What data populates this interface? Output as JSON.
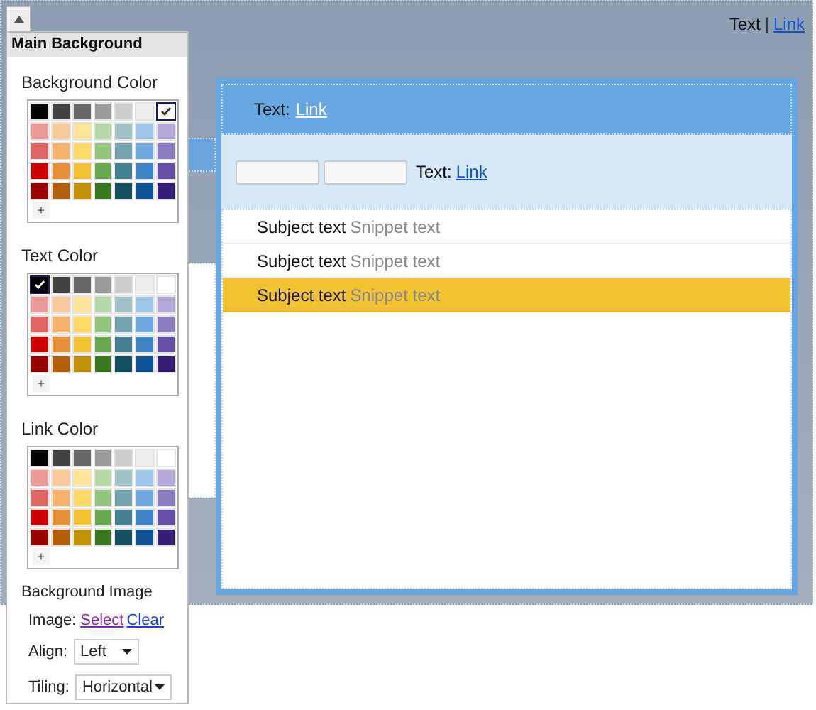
{
  "panel": {
    "title": "Main Background",
    "palettes": [
      {
        "label": "Background Color",
        "add_button": "+",
        "swatches": [
          {
            "color": "#000000",
            "selected": false
          },
          {
            "color": "#434343",
            "selected": false
          },
          {
            "color": "#666666",
            "selected": false
          },
          {
            "color": "#999999",
            "selected": false
          },
          {
            "color": "#cccccc",
            "selected": false
          },
          {
            "color": "#efefef",
            "selected": false
          },
          {
            "color": "#ffffff",
            "selected": true
          },
          {
            "color": "#ea9999",
            "selected": false
          },
          {
            "color": "#f9cb9c",
            "selected": false
          },
          {
            "color": "#ffe599",
            "selected": false
          },
          {
            "color": "#b6d7a8",
            "selected": false
          },
          {
            "color": "#a2c4c9",
            "selected": false
          },
          {
            "color": "#9fc5e8",
            "selected": false
          },
          {
            "color": "#b4a7d6",
            "selected": false
          },
          {
            "color": "#e06666",
            "selected": false
          },
          {
            "color": "#f6b26b",
            "selected": false
          },
          {
            "color": "#ffd966",
            "selected": false
          },
          {
            "color": "#93c47d",
            "selected": false
          },
          {
            "color": "#76a5af",
            "selected": false
          },
          {
            "color": "#6fa8dc",
            "selected": false
          },
          {
            "color": "#8e7cc3",
            "selected": false
          },
          {
            "color": "#cc0000",
            "selected": false
          },
          {
            "color": "#e69138",
            "selected": false
          },
          {
            "color": "#f1c232",
            "selected": false
          },
          {
            "color": "#6aa84f",
            "selected": false
          },
          {
            "color": "#45818e",
            "selected": false
          },
          {
            "color": "#3d85c6",
            "selected": false
          },
          {
            "color": "#674ea7",
            "selected": false
          },
          {
            "color": "#990000",
            "selected": false
          },
          {
            "color": "#b45f06",
            "selected": false
          },
          {
            "color": "#bf9000",
            "selected": false
          },
          {
            "color": "#38761d",
            "selected": false
          },
          {
            "color": "#134f5c",
            "selected": false
          },
          {
            "color": "#0b5394",
            "selected": false
          },
          {
            "color": "#351c75",
            "selected": false
          }
        ]
      },
      {
        "label": "Text Color",
        "add_button": "+",
        "swatches": [
          {
            "color": "#000000",
            "selected": true
          },
          {
            "color": "#434343",
            "selected": false
          },
          {
            "color": "#666666",
            "selected": false
          },
          {
            "color": "#999999",
            "selected": false
          },
          {
            "color": "#cccccc",
            "selected": false
          },
          {
            "color": "#efefef",
            "selected": false
          },
          {
            "color": "#ffffff",
            "selected": false
          },
          {
            "color": "#ea9999",
            "selected": false
          },
          {
            "color": "#f9cb9c",
            "selected": false
          },
          {
            "color": "#ffe599",
            "selected": false
          },
          {
            "color": "#b6d7a8",
            "selected": false
          },
          {
            "color": "#a2c4c9",
            "selected": false
          },
          {
            "color": "#9fc5e8",
            "selected": false
          },
          {
            "color": "#b4a7d6",
            "selected": false
          },
          {
            "color": "#e06666",
            "selected": false
          },
          {
            "color": "#f6b26b",
            "selected": false
          },
          {
            "color": "#ffd966",
            "selected": false
          },
          {
            "color": "#93c47d",
            "selected": false
          },
          {
            "color": "#76a5af",
            "selected": false
          },
          {
            "color": "#6fa8dc",
            "selected": false
          },
          {
            "color": "#8e7cc3",
            "selected": false
          },
          {
            "color": "#cc0000",
            "selected": false
          },
          {
            "color": "#e69138",
            "selected": false
          },
          {
            "color": "#f1c232",
            "selected": false
          },
          {
            "color": "#6aa84f",
            "selected": false
          },
          {
            "color": "#45818e",
            "selected": false
          },
          {
            "color": "#3d85c6",
            "selected": false
          },
          {
            "color": "#674ea7",
            "selected": false
          },
          {
            "color": "#990000",
            "selected": false
          },
          {
            "color": "#b45f06",
            "selected": false
          },
          {
            "color": "#bf9000",
            "selected": false
          },
          {
            "color": "#38761d",
            "selected": false
          },
          {
            "color": "#134f5c",
            "selected": false
          },
          {
            "color": "#0b5394",
            "selected": false
          },
          {
            "color": "#351c75",
            "selected": false
          }
        ]
      },
      {
        "label": "Link Color",
        "add_button": "+",
        "swatches": [
          {
            "color": "#000000",
            "selected": false
          },
          {
            "color": "#434343",
            "selected": false
          },
          {
            "color": "#666666",
            "selected": false
          },
          {
            "color": "#999999",
            "selected": false
          },
          {
            "color": "#cccccc",
            "selected": false
          },
          {
            "color": "#efefef",
            "selected": false
          },
          {
            "color": "#ffffff",
            "selected": false
          },
          {
            "color": "#ea9999",
            "selected": false
          },
          {
            "color": "#f9cb9c",
            "selected": false
          },
          {
            "color": "#ffe599",
            "selected": false
          },
          {
            "color": "#b6d7a8",
            "selected": false
          },
          {
            "color": "#a2c4c9",
            "selected": false
          },
          {
            "color": "#9fc5e8",
            "selected": false
          },
          {
            "color": "#b4a7d6",
            "selected": false
          },
          {
            "color": "#e06666",
            "selected": false
          },
          {
            "color": "#f6b26b",
            "selected": false
          },
          {
            "color": "#ffd966",
            "selected": false
          },
          {
            "color": "#93c47d",
            "selected": false
          },
          {
            "color": "#76a5af",
            "selected": false
          },
          {
            "color": "#6fa8dc",
            "selected": false
          },
          {
            "color": "#8e7cc3",
            "selected": false
          },
          {
            "color": "#cc0000",
            "selected": false
          },
          {
            "color": "#e69138",
            "selected": false
          },
          {
            "color": "#f1c232",
            "selected": false
          },
          {
            "color": "#6aa84f",
            "selected": false
          },
          {
            "color": "#45818e",
            "selected": false
          },
          {
            "color": "#3d85c6",
            "selected": false
          },
          {
            "color": "#674ea7",
            "selected": false
          },
          {
            "color": "#990000",
            "selected": false
          },
          {
            "color": "#b45f06",
            "selected": false
          },
          {
            "color": "#bf9000",
            "selected": false
          },
          {
            "color": "#38761d",
            "selected": false
          },
          {
            "color": "#134f5c",
            "selected": false
          },
          {
            "color": "#0b5394",
            "selected": false
          },
          {
            "color": "#351c75",
            "selected": false
          }
        ]
      }
    ],
    "background_image": {
      "label": "Background Image",
      "image_label": "Image:",
      "select_link": "Select",
      "clear_link": "Clear",
      "align_label": "Align:",
      "align_value": "Left",
      "tiling_label": "Tiling:",
      "tiling_value": "Horizontal"
    }
  },
  "preview": {
    "top_bar": {
      "text": "Text",
      "separator": "|",
      "link": "Link"
    },
    "header": {
      "text": "Text:",
      "link": "Link"
    },
    "toolbar": {
      "text": "Text:",
      "link": "Link"
    },
    "rows": [
      {
        "subject": "Subject text",
        "snippet": "Snippet text",
        "selected": false
      },
      {
        "subject": "Subject text",
        "snippet": "Snippet text",
        "selected": false
      },
      {
        "subject": "Subject text",
        "snippet": "Snippet text",
        "selected": true
      }
    ]
  }
}
